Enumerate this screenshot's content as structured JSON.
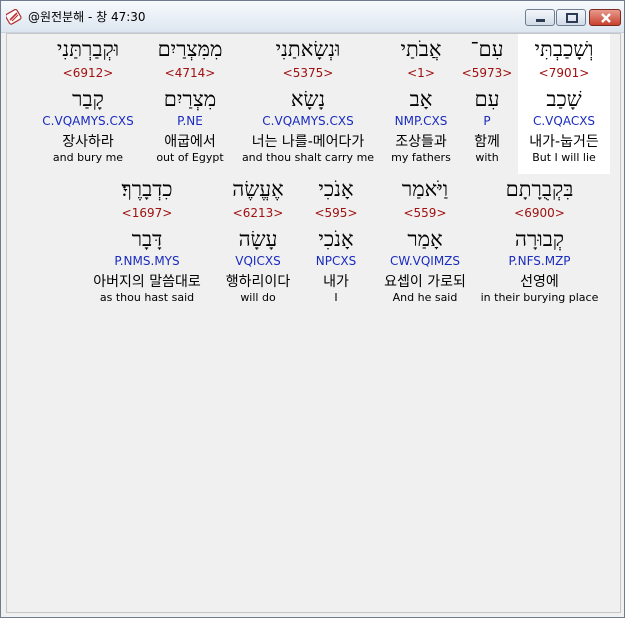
{
  "window": {
    "title": "@원전분해 - 창 47:30"
  },
  "verse": {
    "row1": [
      {
        "heb": "וְשָׁכַבְתִּי",
        "strong": "<7901>",
        "lemma": "שָׁכַב",
        "morph": "C.VQACXS",
        "kor": "내가-눕거든",
        "eng": "But I will lie",
        "selected": true
      },
      {
        "heb": "עִם־",
        "strong": "<5973>",
        "lemma": "עִם",
        "morph": "P",
        "kor": "함께",
        "eng": "with"
      },
      {
        "heb": "אֲבֹתַי",
        "strong": "<1>",
        "lemma": "אָב",
        "morph": "NMP.CXS",
        "kor": "조상들과",
        "eng": "my fathers"
      },
      {
        "heb": "וּנְשָׂאתַנִי",
        "strong": "<5375>",
        "lemma": "נָשָׂא",
        "morph": "C.VQAMYS.CXS",
        "kor": "너는 나를-메어다가",
        "eng": "and thou shalt carry me"
      },
      {
        "heb": "מִמִּצְרַיִם",
        "strong": "<4714>",
        "lemma": "מִצְרַיִם",
        "morph": "P.NE",
        "kor": "애굽에서",
        "eng": "out of Egypt"
      },
      {
        "heb": "וּקְבַרְתַּנִי",
        "strong": "<6912>",
        "lemma": "קָבַר",
        "morph": "C.VQAMYS.CXS",
        "kor": "장사하라",
        "eng": "and bury me"
      }
    ],
    "row2": [
      {
        "heb": "בִּקְבֻרָתָם",
        "strong": "<6900>",
        "lemma": "קְבוּרָה",
        "morph": "P.NFS.MZP",
        "kor": "선영에",
        "eng": "in their burying place"
      },
      {
        "heb": "וַיֹּאמַר",
        "strong": "<559>",
        "lemma": "אָמַר",
        "morph": "CW.VQIMZS",
        "kor": "요셉이 가로되",
        "eng": "And he said"
      },
      {
        "heb": "אָנֹכִי",
        "strong": "<595>",
        "lemma": "אָנֹכִי",
        "morph": "NPCXS",
        "kor": "내가",
        "eng": "I"
      },
      {
        "heb": "אֶעֱשֶׂה",
        "strong": "<6213>",
        "lemma": "עָשָׂה",
        "morph": "VQICXS",
        "kor": "행하리이다",
        "eng": "will do"
      },
      {
        "heb": "כִדְבָרֶךָ׃",
        "strong": "<1697>",
        "lemma": "דָּבָר",
        "morph": "P.NMS.MYS",
        "kor": "아버지의 말씀대로",
        "eng": "as thou hast said"
      }
    ]
  },
  "colors": {
    "strong": "#a01010",
    "morph": "#1a2bbf",
    "selected_bg": "#ffffff"
  }
}
